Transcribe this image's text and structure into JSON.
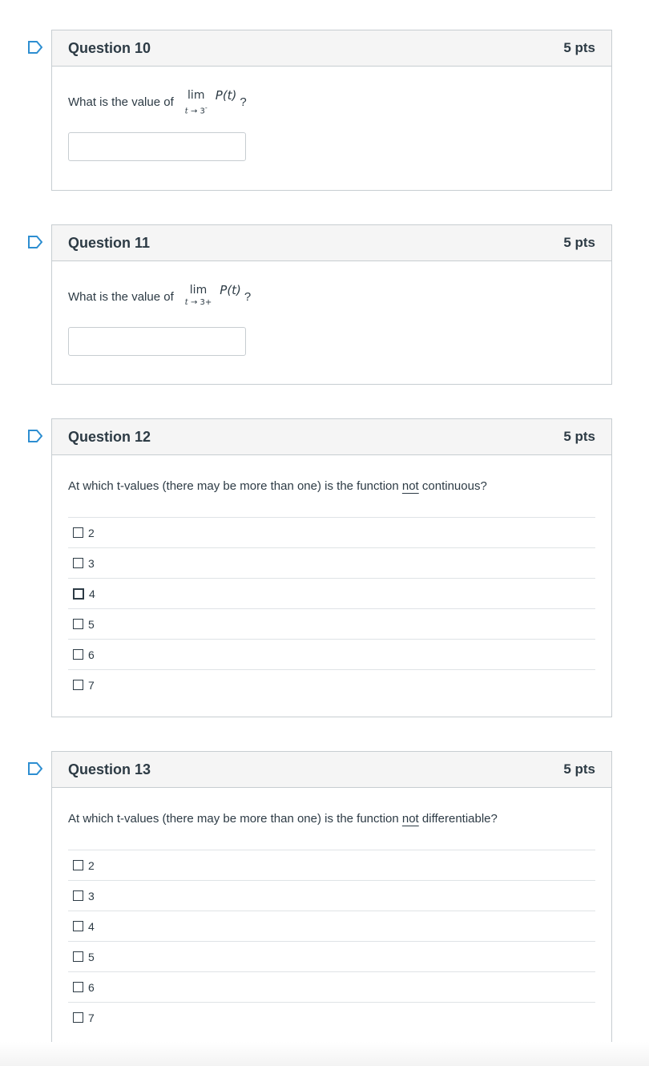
{
  "q10": {
    "title": "Question 10",
    "points": "5 pts",
    "prompt": "What is the value of",
    "lim": "lim",
    "sub_var": "t",
    "sub_arrow": " → ",
    "sub_target": "3",
    "sub_side": "-",
    "func": "P(t)",
    "end": "?",
    "answer_value": ""
  },
  "q11": {
    "title": "Question 11",
    "points": "5 pts",
    "prompt": "What is the value of",
    "lim": "lim",
    "sub_var": "t",
    "sub_arrow": " → ",
    "sub_target": "3",
    "sub_side": "+",
    "func": "P(t)",
    "end": "?",
    "answer_value": ""
  },
  "q12": {
    "title": "Question 12",
    "points": "5 pts",
    "text_before": "At which t-values (there may be more than one) is the function ",
    "text_underlined": "not",
    "text_after": " continuous?",
    "options": [
      "2",
      "3",
      "4",
      "5",
      "6",
      "7"
    ]
  },
  "q13": {
    "title": "Question 13",
    "points": "5 pts",
    "text_before": "At which t-values (there may be more than one) is the function ",
    "text_underlined": "not",
    "text_after": " differentiable?",
    "options": [
      "2",
      "3",
      "4",
      "5",
      "6",
      "7"
    ]
  },
  "colors": {
    "flag_blue": "#2d8ed1",
    "text": "#2d3b45",
    "border": "#c7cdd1",
    "header_bg": "#f5f5f5"
  },
  "icons": {
    "flag": "bookmark-flag-icon",
    "checkbox": "checkbox-icon"
  }
}
